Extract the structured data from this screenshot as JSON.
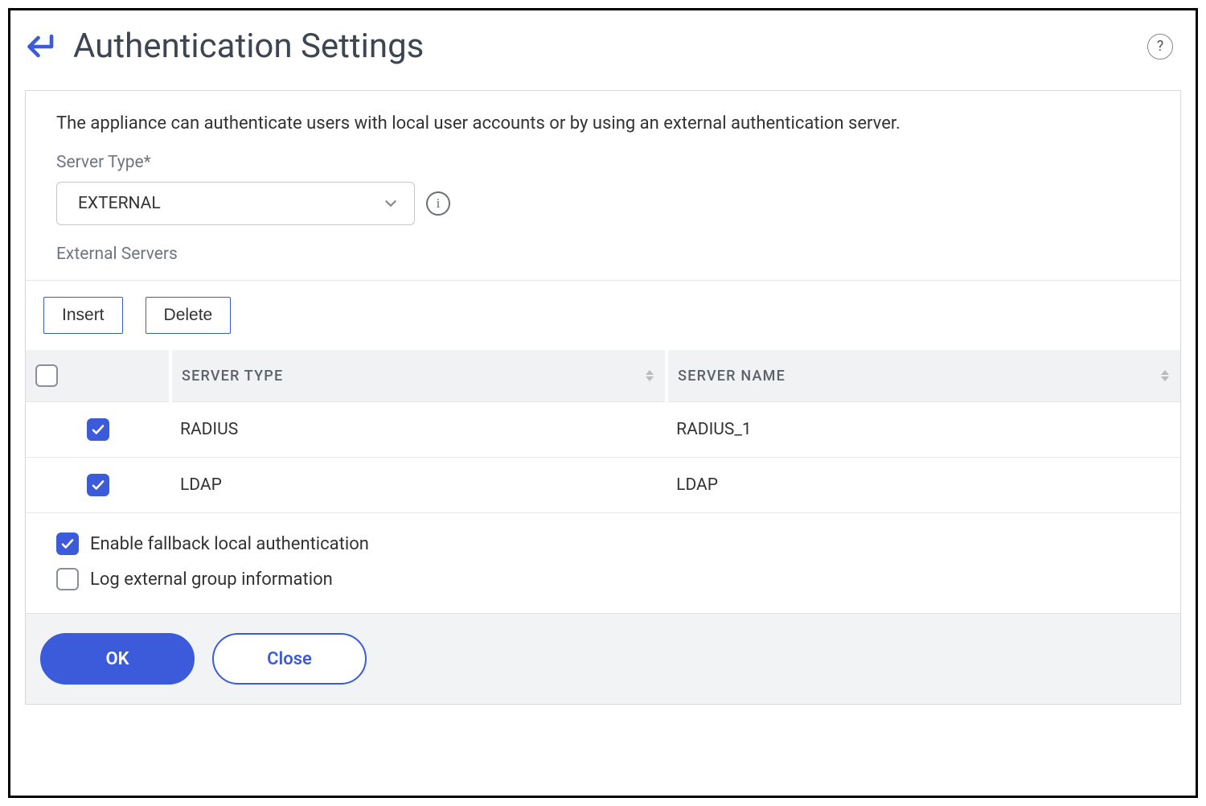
{
  "header": {
    "title": "Authentication Settings"
  },
  "main": {
    "description": "The appliance can authenticate users with local user accounts or by using an external authentication server.",
    "server_type_label": "Server Type*",
    "server_type_value": "EXTERNAL",
    "external_servers_label": "External Servers"
  },
  "toolbar": {
    "insert_label": "Insert",
    "delete_label": "Delete"
  },
  "table": {
    "columns": {
      "type": "SERVER TYPE",
      "name": "SERVER NAME"
    },
    "rows": [
      {
        "checked": true,
        "type": "RADIUS",
        "name": "RADIUS_1"
      },
      {
        "checked": true,
        "type": "LDAP",
        "name": "LDAP"
      }
    ]
  },
  "options": {
    "fallback_label": "Enable fallback local authentication",
    "fallback_checked": true,
    "log_group_label": "Log external group information",
    "log_group_checked": false
  },
  "footer": {
    "ok_label": "OK",
    "close_label": "Close"
  }
}
